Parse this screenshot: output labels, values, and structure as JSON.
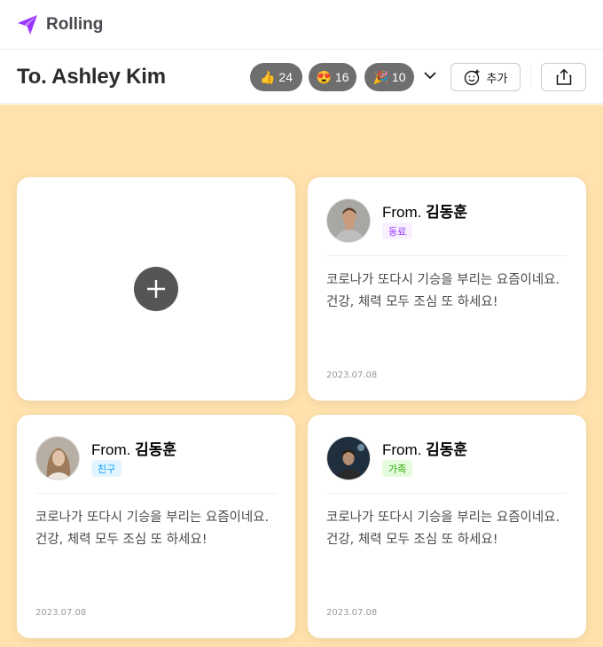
{
  "app": {
    "name": "Rolling",
    "logo_icon": "paper-plane-icon",
    "brand_color": "#9935ff"
  },
  "header": {
    "recipient": "To. Ashley Kim",
    "reactions": [
      {
        "emoji": "👍",
        "count": "24"
      },
      {
        "emoji": "😍",
        "count": "16"
      },
      {
        "emoji": "🎉",
        "count": "10"
      }
    ],
    "add_label": "추가"
  },
  "board": {
    "background_color": "#ffe2ad",
    "cards": [
      {
        "from_prefix": "From.",
        "from_name": "김동훈",
        "relation": "동료",
        "message_line1": "코로나가 또다시 기승을 부리는 요즘이네요.",
        "message_line2": "건강, 체력 모두 조심 또 하세요!",
        "date": "2023.07.08"
      },
      {
        "from_prefix": "From.",
        "from_name": "김동훈",
        "relation": "친구",
        "message_line1": "코로나가 또다시 기승을 부리는 요즘이네요.",
        "message_line2": "건강, 체력 모두 조심 또 하세요!",
        "date": "2023.07.08"
      },
      {
        "from_prefix": "From.",
        "from_name": "김동훈",
        "relation": "가족",
        "message_line1": "코로나가 또다시 기승을 부리는 요즘이네요.",
        "message_line2": "건강, 체력 모두 조심 또 하세요!",
        "date": "2023.07.08"
      }
    ]
  }
}
